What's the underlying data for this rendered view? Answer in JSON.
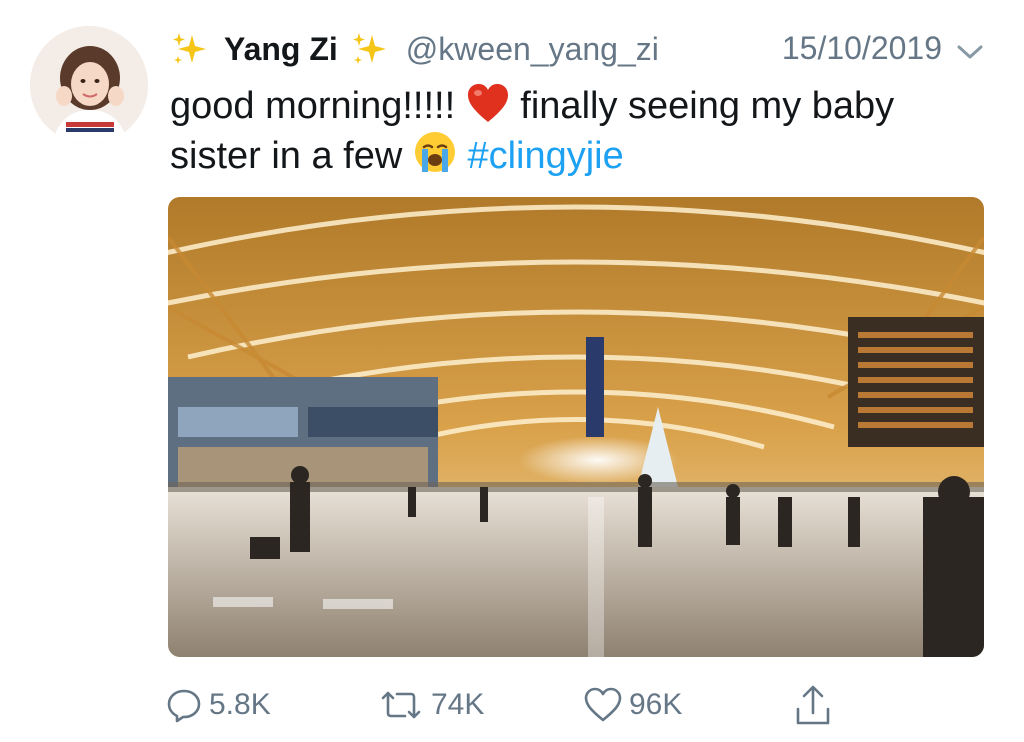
{
  "tweet": {
    "display_name": "Yang Zi",
    "name_emoji": "sparkles",
    "handle": "@kween_yang_zi",
    "date": "15/10/2019",
    "menu_icon": "chevron-down-icon",
    "text_line1_part1": "good morning!!!!!",
    "text_line1_part2": "finally seeing my baby",
    "text_line2_part1": "sister in a few",
    "hashtag": "#clingyjie",
    "emoji_1": "red-heart",
    "emoji_2": "loudly-crying-face"
  },
  "media": {
    "subject": "airport terminal hall with curved golden roof"
  },
  "actions": {
    "reply_count": "5.8K",
    "retweet_count": "74K",
    "like_count": "96K",
    "reply_icon": "reply-icon",
    "retweet_icon": "retweet-icon",
    "like_icon": "heart-icon",
    "share_icon": "share-icon"
  },
  "colors": {
    "hashtag": "#1da1f2",
    "secondary_text": "#657786",
    "primary_text": "#14171a"
  }
}
